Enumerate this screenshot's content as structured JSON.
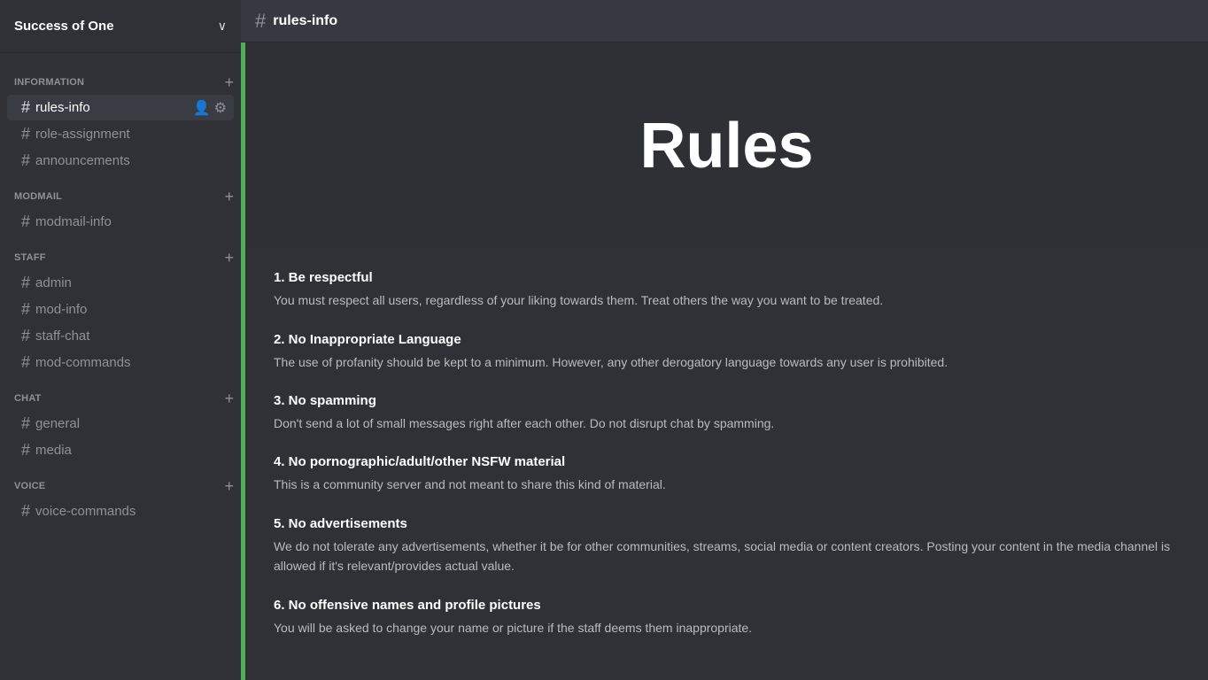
{
  "server": {
    "name": "Success of One",
    "chevron": "∨"
  },
  "header": {
    "channel_hash": "#",
    "channel_name": "rules-info"
  },
  "banner": {
    "title": "Rules"
  },
  "categories": [
    {
      "id": "information",
      "label": "INFORMATION",
      "channels": [
        {
          "id": "rules-info",
          "name": "rules-info",
          "active": true
        },
        {
          "id": "role-assignment",
          "name": "role-assignment",
          "active": false
        },
        {
          "id": "announcements",
          "name": "announcements",
          "active": false
        }
      ]
    },
    {
      "id": "modmail",
      "label": "MODMAIL",
      "channels": [
        {
          "id": "modmail-info",
          "name": "modmail-info",
          "active": false
        }
      ]
    },
    {
      "id": "staff",
      "label": "STAFF",
      "channels": [
        {
          "id": "admin",
          "name": "admin",
          "active": false
        },
        {
          "id": "mod-info",
          "name": "mod-info",
          "active": false
        },
        {
          "id": "staff-chat",
          "name": "staff-chat",
          "active": false
        },
        {
          "id": "mod-commands",
          "name": "mod-commands",
          "active": false
        }
      ]
    },
    {
      "id": "chat",
      "label": "CHAT",
      "channels": [
        {
          "id": "general",
          "name": "general",
          "active": false
        },
        {
          "id": "media",
          "name": "media",
          "active": false
        }
      ]
    },
    {
      "id": "voice",
      "label": "VOICE",
      "channels": [
        {
          "id": "voice-commands",
          "name": "voice-commands",
          "active": false
        }
      ]
    }
  ],
  "rules": [
    {
      "id": "rule-1",
      "title": "1. Be respectful",
      "description": "You must respect all users, regardless of your liking towards them. Treat others the way you want to be treated."
    },
    {
      "id": "rule-2",
      "title": "2. No Inappropriate Language",
      "description": "The use of profanity should be kept to a minimum. However, any other derogatory language towards any user is prohibited."
    },
    {
      "id": "rule-3",
      "title": "3. No spamming",
      "description": "Don't send a lot of small messages right after each other. Do not disrupt chat by spamming."
    },
    {
      "id": "rule-4",
      "title": "4. No pornographic/adult/other NSFW material",
      "description": "This is a community server and not meant to share this kind of material."
    },
    {
      "id": "rule-5",
      "title": "5. No advertisements",
      "description": "We do not tolerate any advertisements, whether it be for other communities, streams, social media or content creators. Posting your content in the media channel is allowed if it's relevant/provides actual value."
    },
    {
      "id": "rule-6",
      "title": "6. No offensive names and profile pictures",
      "description": "You will be asked to change your name or picture if the staff deems them inappropriate."
    }
  ],
  "icons": {
    "hash": "#",
    "add": "+",
    "add_member": "👤+",
    "gear": "⚙"
  }
}
